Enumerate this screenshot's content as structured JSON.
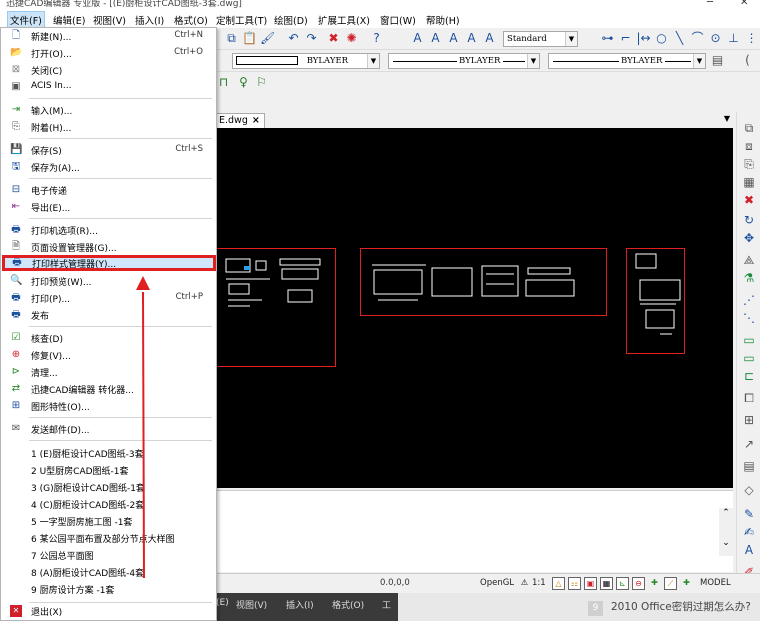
{
  "window": {
    "title": "迅捷CAD编辑器 专业版 - [(E)厨柜设计CAD图纸-3套.dwg]"
  },
  "menubar": {
    "items": [
      "文件(F)",
      "编辑(E)",
      "视图(V)",
      "插入(I)",
      "格式(O)",
      "定制工具(T)",
      "绘图(D)",
      "扩展工具(X)",
      "窗口(W)",
      "帮助(H)"
    ]
  },
  "toolbar": {
    "text_style": "Standard",
    "color_combo": "BYLAYER",
    "linetype_combo": "BYLAYER",
    "lineweight_combo": "BYLAYER"
  },
  "document": {
    "tab_label": "E.dwg",
    "close_glyph": "×"
  },
  "file_menu": {
    "items": [
      {
        "label": "新建(N)...",
        "shortcut": "Ctrl+N",
        "icon": "new-file-icon"
      },
      {
        "label": "打开(O)...",
        "shortcut": "Ctrl+O",
        "icon": "open-folder-icon"
      },
      {
        "label": "关闭(C)",
        "shortcut": "",
        "icon": "close-file-icon"
      },
      {
        "label": "ACIS In...",
        "shortcut": "",
        "icon": "acis-icon"
      },
      {
        "label": "输入(M)...",
        "shortcut": "",
        "icon": "import-icon"
      },
      {
        "label": "附着(H)...",
        "shortcut": "",
        "icon": "attach-icon"
      },
      {
        "label": "保存(S)",
        "shortcut": "Ctrl+S",
        "icon": "save-icon"
      },
      {
        "label": "保存为(A)...",
        "shortcut": "",
        "icon": "save-as-icon"
      },
      {
        "label": "电子传递",
        "shortcut": "",
        "icon": "etransmit-icon"
      },
      {
        "label": "导出(E)...",
        "shortcut": "",
        "icon": "export-icon"
      },
      {
        "label": "打印机选项(R)...",
        "shortcut": "",
        "icon": "printer-options-icon"
      },
      {
        "label": "页面设置管理器(G)...",
        "shortcut": "",
        "icon": "page-setup-icon"
      },
      {
        "label": "打印样式管理器(Y)...",
        "shortcut": "",
        "icon": "plot-style-icon"
      },
      {
        "label": "打印预览(W)...",
        "shortcut": "",
        "icon": "print-preview-icon"
      },
      {
        "label": "打印(P)...",
        "shortcut": "Ctrl+P",
        "icon": "print-icon"
      },
      {
        "label": "发布",
        "shortcut": "",
        "icon": "publish-icon"
      },
      {
        "label": "核查(D)",
        "shortcut": "",
        "icon": "audit-icon"
      },
      {
        "label": "修复(V)...",
        "shortcut": "",
        "icon": "recover-icon"
      },
      {
        "label": "清理...",
        "shortcut": "",
        "icon": "purge-icon"
      },
      {
        "label": "迅捷CAD编辑器 转化器...",
        "shortcut": "",
        "icon": "converter-icon"
      },
      {
        "label": "图形特性(O)...",
        "shortcut": "",
        "icon": "drawing-properties-icon"
      },
      {
        "label": "发送邮件(D)...",
        "shortcut": "",
        "icon": "send-mail-icon"
      }
    ],
    "recent": [
      "1 (E)厨柜设计CAD图纸-3套",
      "2 U型厨房CAD图纸-1套",
      "3 (G)厨柜设计CAD图纸-1套",
      "4 (C)厨柜设计CAD图纸-2套",
      "5 一字型厨房施工图 -1套",
      "6 某公园平面布置及部分节点大样图",
      "7 公园总平面图",
      "8 (A)厨柜设计CAD图纸-4套",
      "9 厨房设计方案 -1套"
    ],
    "exit_label": "退出(X)"
  },
  "statusbar": {
    "coords": "0.0,0,0",
    "opengl": "OpenGL",
    "scale": "1:1",
    "model": "MODEL"
  },
  "taskbar": {
    "menu_items": [
      "(E)",
      "视图(V)",
      "插入(I)",
      "格式(O)",
      "工"
    ],
    "hint_number": "9",
    "hint_text": "2010 Office密钥过期怎么办?"
  },
  "colors": {
    "highlight_border": "#e02020",
    "canvas_bg": "#000000",
    "frame_red": "#e02020"
  }
}
